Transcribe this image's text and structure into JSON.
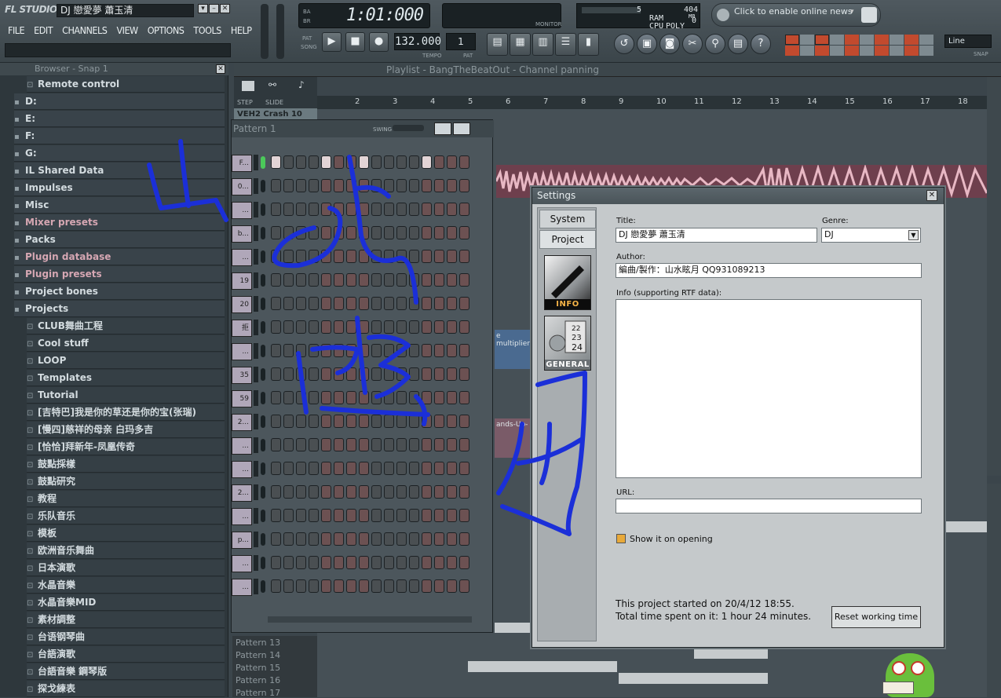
{
  "app": {
    "logo": "FL STUDIO",
    "song_name": "DJ 戀愛夢 蕭玉清",
    "menu": [
      "FILE",
      "EDIT",
      "CHANNELS",
      "VIEW",
      "OPTIONS",
      "TOOLS",
      "HELP"
    ]
  },
  "transport": {
    "time": "1:01:000",
    "tempo": "132.000",
    "tempo_label": "TEMPO",
    "pat_label": "PAT",
    "song_label": "SONG",
    "pat_value": "1",
    "monitor_label": "MONITOR"
  },
  "cpu_panel": {
    "value1": "5",
    "value2": "404",
    "value3": "0",
    "ram_label": "RAM",
    "mb_label": "MB",
    "cpu_label": "CPU",
    "poly_label": "POLY"
  },
  "news": {
    "text": "Click to enable online news"
  },
  "snap": {
    "label": "SNAP",
    "value": "Line"
  },
  "browser": {
    "title": "Browser - Snap 1",
    "items": [
      {
        "label": "Remote control",
        "sub": true
      },
      {
        "label": "D:",
        "sub": false
      },
      {
        "label": "E:",
        "sub": false
      },
      {
        "label": "F:",
        "sub": false
      },
      {
        "label": "G:",
        "sub": false
      },
      {
        "label": "IL Shared Data",
        "sub": false
      },
      {
        "label": "Impulses",
        "sub": false
      },
      {
        "label": "Misc",
        "sub": false
      },
      {
        "label": "Mixer presets",
        "sub": false,
        "pink": true
      },
      {
        "label": "Packs",
        "sub": false
      },
      {
        "label": "Plugin database",
        "sub": false,
        "pink": true
      },
      {
        "label": "Plugin presets",
        "sub": false,
        "pink": true
      },
      {
        "label": "Project bones",
        "sub": false
      },
      {
        "label": "Projects",
        "sub": false
      },
      {
        "label": "CLUB舞曲工程",
        "sub": true
      },
      {
        "label": "Cool stuff",
        "sub": true
      },
      {
        "label": "LOOP",
        "sub": true
      },
      {
        "label": "Templates",
        "sub": true
      },
      {
        "label": "Tutorial",
        "sub": true
      },
      {
        "label": "[吉特巴]我是你的草还是你的宝(张瑞)",
        "sub": true
      },
      {
        "label": "[慢四]慈祥的母亲 白玛多吉",
        "sub": true
      },
      {
        "label": "[恰恰]拜新年-凤凰传奇",
        "sub": true
      },
      {
        "label": "鼓點採樣",
        "sub": true
      },
      {
        "label": "鼓點研究",
        "sub": true
      },
      {
        "label": "教程",
        "sub": true
      },
      {
        "label": "乐队音乐",
        "sub": true
      },
      {
        "label": "模板",
        "sub": true
      },
      {
        "label": "欧洲音乐舞曲",
        "sub": true
      },
      {
        "label": "日本演歌",
        "sub": true
      },
      {
        "label": "水晶音樂",
        "sub": true
      },
      {
        "label": "水晶音樂MID",
        "sub": true
      },
      {
        "label": "素材調整",
        "sub": true
      },
      {
        "label": "台语钢琴曲",
        "sub": true
      },
      {
        "label": "台語演歌",
        "sub": true
      },
      {
        "label": "台語音樂 鋼琴版",
        "sub": true
      },
      {
        "label": "探戈練表",
        "sub": true
      }
    ]
  },
  "playlist": {
    "title": "Playlist - BangTheBeatOut - Channel panning",
    "step_label": "STEP",
    "slide_label": "SLIDE",
    "ruler": [
      "2",
      "3",
      "4",
      "5",
      "6",
      "7",
      "8",
      "9",
      "10",
      "11",
      "12",
      "13",
      "14",
      "15",
      "16",
      "17",
      "18"
    ],
    "clip_labels": [
      "VEH2 Crash 10",
      "e multiplier",
      "ands-Up-"
    ],
    "patterns": [
      "Pattern 13",
      "Pattern 14",
      "Pattern 15",
      "Pattern 16",
      "Pattern 17"
    ]
  },
  "step_sequencer": {
    "title": "Pattern 1",
    "swing_label": "SWING",
    "channel_tags": [
      "F...",
      "0...",
      "...",
      "b...",
      "...",
      "19",
      "20",
      "拒",
      "...",
      "35",
      "59",
      "2...",
      "...",
      "...",
      "2...",
      "...",
      "p...",
      "...",
      "..."
    ]
  },
  "settings": {
    "title": "Settings",
    "tabs": [
      "System",
      "Project"
    ],
    "info_label": "INFO",
    "general_label": "GENERAL",
    "title_label": "Title:",
    "title_value": "DJ 戀愛夢 蕭玉清",
    "genre_label": "Genre:",
    "genre_value": "DJ",
    "author_label": "Author:",
    "author_value": "編曲/製作：山水眩月 QQ931089213",
    "info_field_label": "Info (supporting RTF data):",
    "url_label": "URL:",
    "show_on_opening": "Show it on opening",
    "started": "This project started on 20/4/12 18:55.",
    "time_spent": "Total time spent on it: 1 hour 24 minutes.",
    "reset_button": "Reset working time"
  },
  "colors": {
    "accent_blue": "#1b2fd8",
    "step_light": "#a58e90",
    "step_dark": "#5c4a4b",
    "wave_pink": "#e8b8c4"
  }
}
